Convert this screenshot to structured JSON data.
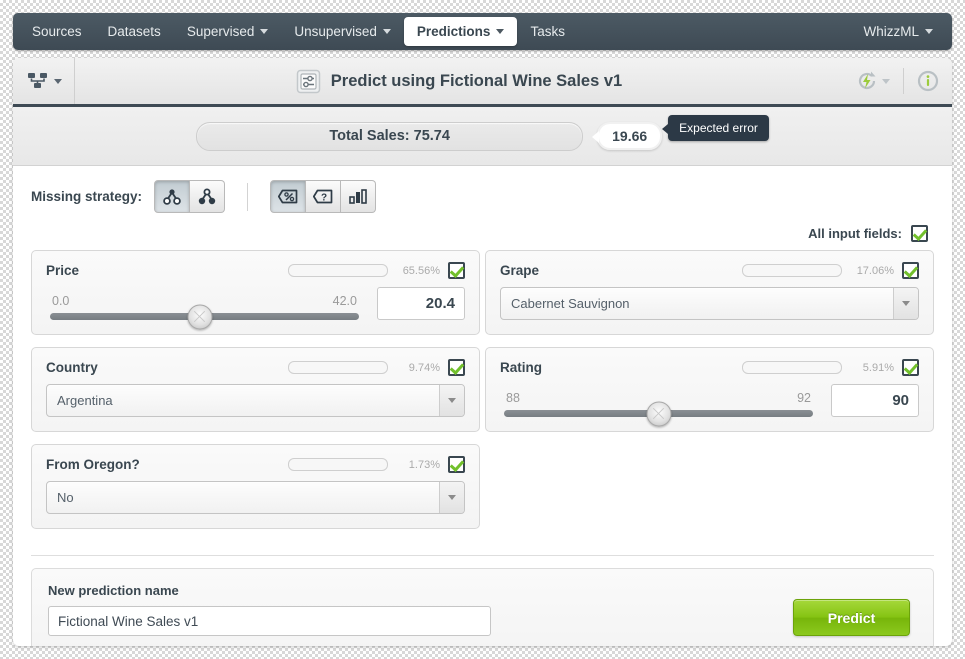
{
  "nav": {
    "items": [
      {
        "label": "Sources",
        "caret": false,
        "active": false,
        "name": "nav-sources"
      },
      {
        "label": "Datasets",
        "caret": false,
        "active": false,
        "name": "nav-datasets"
      },
      {
        "label": "Supervised",
        "caret": true,
        "active": false,
        "name": "nav-supervised"
      },
      {
        "label": "Unsupervised",
        "caret": true,
        "active": false,
        "name": "nav-unsupervised"
      },
      {
        "label": "Predictions",
        "caret": true,
        "active": true,
        "name": "nav-predictions"
      },
      {
        "label": "Tasks",
        "caret": false,
        "active": false,
        "name": "nav-tasks"
      }
    ],
    "right": {
      "label": "WhizzML",
      "caret": true
    }
  },
  "header": {
    "title": "Predict using Fictional Wine Sales v1",
    "left_icon": "model-tree-icon",
    "title_icon": "prediction-sliders-icon",
    "action_icon": "refresh-lightning-icon",
    "info_icon": "info-icon"
  },
  "result": {
    "objective": "Total Sales: 75.74",
    "expected_error_value": "19.66",
    "expected_error_label": "Expected error"
  },
  "strategy": {
    "label": "Missing strategy:",
    "buttons": [
      {
        "name": "missing-strategy-last-prediction",
        "icon": "tree-hollow-icon",
        "selected": true
      },
      {
        "name": "missing-strategy-proportional",
        "icon": "tree-filled-icon",
        "selected": false
      }
    ],
    "view_buttons": [
      {
        "name": "view-percent",
        "icon": "percent-tag-icon",
        "selected": true
      },
      {
        "name": "view-question",
        "icon": "question-tag-icon",
        "selected": false
      },
      {
        "name": "view-histogram",
        "icon": "histogram-icon",
        "selected": false
      }
    ]
  },
  "all_fields": {
    "label": "All input fields:",
    "checked": true
  },
  "fields": [
    {
      "name": "Price",
      "type": "slider",
      "importance": "65.56%",
      "importance_pct": 65.56,
      "checked": true,
      "min": "0.0",
      "max": "42.0",
      "value": "20.4",
      "thumb_pct": 48.5,
      "data_name": "field-price"
    },
    {
      "name": "Grape",
      "type": "select",
      "importance": "17.06%",
      "importance_pct": 17.06,
      "checked": true,
      "value": "Cabernet Sauvignon",
      "data_name": "field-grape"
    },
    {
      "name": "Country",
      "type": "select",
      "importance": "9.74%",
      "importance_pct": 9.74,
      "checked": true,
      "value": "Argentina",
      "data_name": "field-country"
    },
    {
      "name": "Rating",
      "type": "slider",
      "importance": "5.91%",
      "importance_pct": 5.91,
      "checked": true,
      "min": "88",
      "max": "92",
      "value": "90",
      "thumb_pct": 50,
      "data_name": "field-rating"
    },
    {
      "name": "From Oregon?",
      "type": "select",
      "importance": "1.73%",
      "importance_pct": 1.73,
      "checked": true,
      "value": "No",
      "data_name": "field-from-oregon"
    }
  ],
  "footer": {
    "name_label": "New prediction name",
    "name_value": "Fictional Wine Sales v1",
    "predict_label": "Predict"
  },
  "colors": {
    "accent_green": "#84c312",
    "bar_green": "#9ad43c",
    "navy": "#3e4a54",
    "tooltip_dark": "#2c3946"
  }
}
